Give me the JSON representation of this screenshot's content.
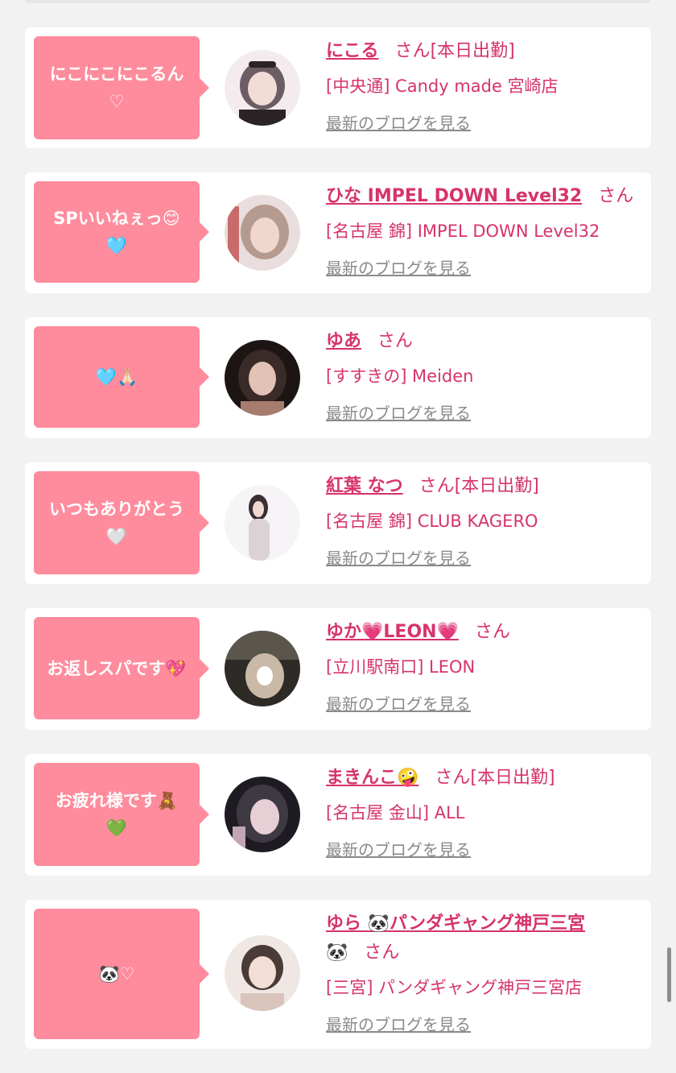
{
  "items": [
    {
      "bubble": "にこにこにこるん\n♡",
      "name": "にこる",
      "san": "さん",
      "badge": "[本日出勤]",
      "shop": "[中央通] Candy made 宮崎店",
      "blog": "最新のブログを見る",
      "avatar_colors": [
        "#f3ebee",
        "#2b2326",
        "#6b5d63"
      ]
    },
    {
      "bubble": "SPいいねぇっ😊\n🩵",
      "name": "ひな IMPEL DOWN Level32",
      "san": "さん",
      "badge": "",
      "shop": "[名古屋 錦] IMPEL DOWN Level32",
      "blog": "最新のブログを見る",
      "avatar_colors": [
        "#e9dedd",
        "#b59b8f",
        "#c96b6b"
      ]
    },
    {
      "bubble": "🩵🙏🏻",
      "name": "ゆあ",
      "san": "さん",
      "badge": "",
      "shop": "[すすきの] Meiden",
      "blog": "最新のブログを見る",
      "avatar_colors": [
        "#3a2a28",
        "#a57c6e",
        "#1c1514"
      ]
    },
    {
      "bubble": "いつもありがとう\n🤍",
      "name": "紅葉 なつ",
      "san": "さん",
      "badge": "[本日出勤]",
      "shop": "[名古屋 錦] CLUB KAGERO",
      "blog": "最新のブログを見る",
      "avatar_colors": [
        "#f6f4f6",
        "#dcd2d4",
        "#3b2f33"
      ]
    },
    {
      "bubble": "お返しスパです💖",
      "name": "ゆか💗LEON💗",
      "san": "さん",
      "badge": "",
      "shop": "[立川駅南口] LEON",
      "blog": "最新のブログを見る",
      "avatar_colors": [
        "#5a564c",
        "#c9b9a6",
        "#2e2b27"
      ]
    },
    {
      "bubble": "お疲れ様です🧸\n💚",
      "name": "まきんこ🤪",
      "san": "さん",
      "badge": "[本日出勤]",
      "shop": "[名古屋 金山] ALL",
      "blog": "最新のブログを見る",
      "avatar_colors": [
        "#3f3944",
        "#c3a6b4",
        "#1f1b22"
      ]
    },
    {
      "bubble": "🐼♡",
      "name": "ゆら 🐼パンダギャング神戸三宮",
      "name_tail": "🐼",
      "san": "さん",
      "badge": "",
      "shop": "[三宮] パンダギャング神戸三宮店",
      "blog": "最新のブログを見る",
      "avatar_colors": [
        "#efe7e4",
        "#4a3b36",
        "#d9c4bc"
      ]
    }
  ]
}
